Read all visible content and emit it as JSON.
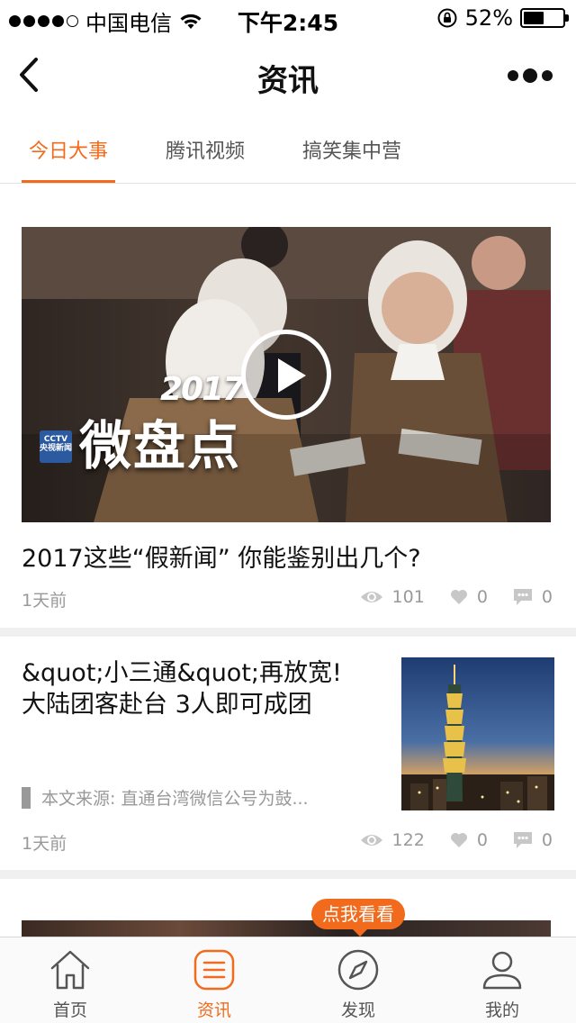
{
  "status_bar": {
    "carrier": "中国电信",
    "time": "下午2:45",
    "battery_pct": "52%",
    "battery_level": 0.52,
    "signal_dots": 5,
    "signal_filled": 4
  },
  "nav": {
    "title": "资讯",
    "back_icon": "chevron-left-icon",
    "more_icon": "more-dots-icon"
  },
  "tabs": [
    {
      "label": "今日大事",
      "active": true
    },
    {
      "label": "腾讯视频",
      "active": false
    },
    {
      "label": "搞笑集中营",
      "active": false
    }
  ],
  "cards": [
    {
      "title": "2017这些“假新闻” 你能鉴别出几个?",
      "overlay_year": "2017",
      "overlay_text": "微盘点",
      "logo_text": "CCTV 央视新闻",
      "time": "1天前",
      "views": "101",
      "likes": "0",
      "comments": "0"
    },
    {
      "title_line1": "&quot;小三通&quot;再放宽!",
      "title_line2": "大陆团客赴台 3人即可成团",
      "source": "本文来源: 直通台湾微信公号为鼓...",
      "time": "1天前",
      "views": "122",
      "likes": "0",
      "comments": "0"
    }
  ],
  "badge": "点我看看",
  "bottom_nav": [
    {
      "label": "首页",
      "icon": "home-icon",
      "active": false
    },
    {
      "label": "资讯",
      "icon": "list-icon",
      "active": true
    },
    {
      "label": "发现",
      "icon": "compass-icon",
      "active": false
    },
    {
      "label": "我的",
      "icon": "user-icon",
      "active": false
    }
  ],
  "colors": {
    "accent": "#f26b1d",
    "muted": "#999999",
    "band": "#f0f0f0"
  }
}
